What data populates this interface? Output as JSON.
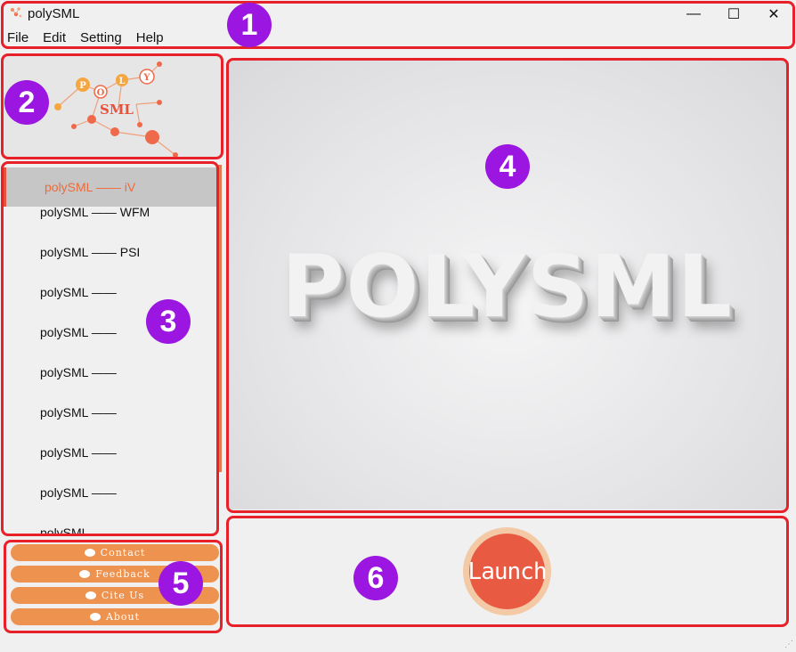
{
  "window": {
    "title": "polySML",
    "controls": {
      "minimize": "—",
      "maximize": "☐",
      "close": "✕"
    }
  },
  "menu": [
    "File",
    "Edit",
    "Setting",
    "Help"
  ],
  "logo": {
    "letters": [
      "P",
      "O",
      "L",
      "Y"
    ],
    "text": "SML"
  },
  "list": {
    "items": [
      {
        "label": "polySML —— iV",
        "selected": true
      },
      {
        "label": "polySML —— WFM",
        "selected": false
      },
      {
        "label": "polySML —— PSI",
        "selected": false
      },
      {
        "label": "polySML ——",
        "selected": false
      },
      {
        "label": "polySML ——",
        "selected": false
      },
      {
        "label": "polySML ——",
        "selected": false
      },
      {
        "label": "polySML ——",
        "selected": false
      },
      {
        "label": "polySML ——",
        "selected": false
      },
      {
        "label": "polySML ——",
        "selected": false
      },
      {
        "label": "polySML ——",
        "selected": false
      }
    ]
  },
  "side_buttons": [
    "Contact",
    "Feedback",
    "Cite Us",
    "About"
  ],
  "main": {
    "title": "POLYSML"
  },
  "launch": {
    "label": "Launch"
  },
  "markers": [
    "1",
    "2",
    "3",
    "4",
    "5",
    "6"
  ],
  "colors": {
    "highlight": "#e8202a",
    "marker": "#9b16e0",
    "accent": "#ee924f",
    "launch": "#e95a42"
  }
}
